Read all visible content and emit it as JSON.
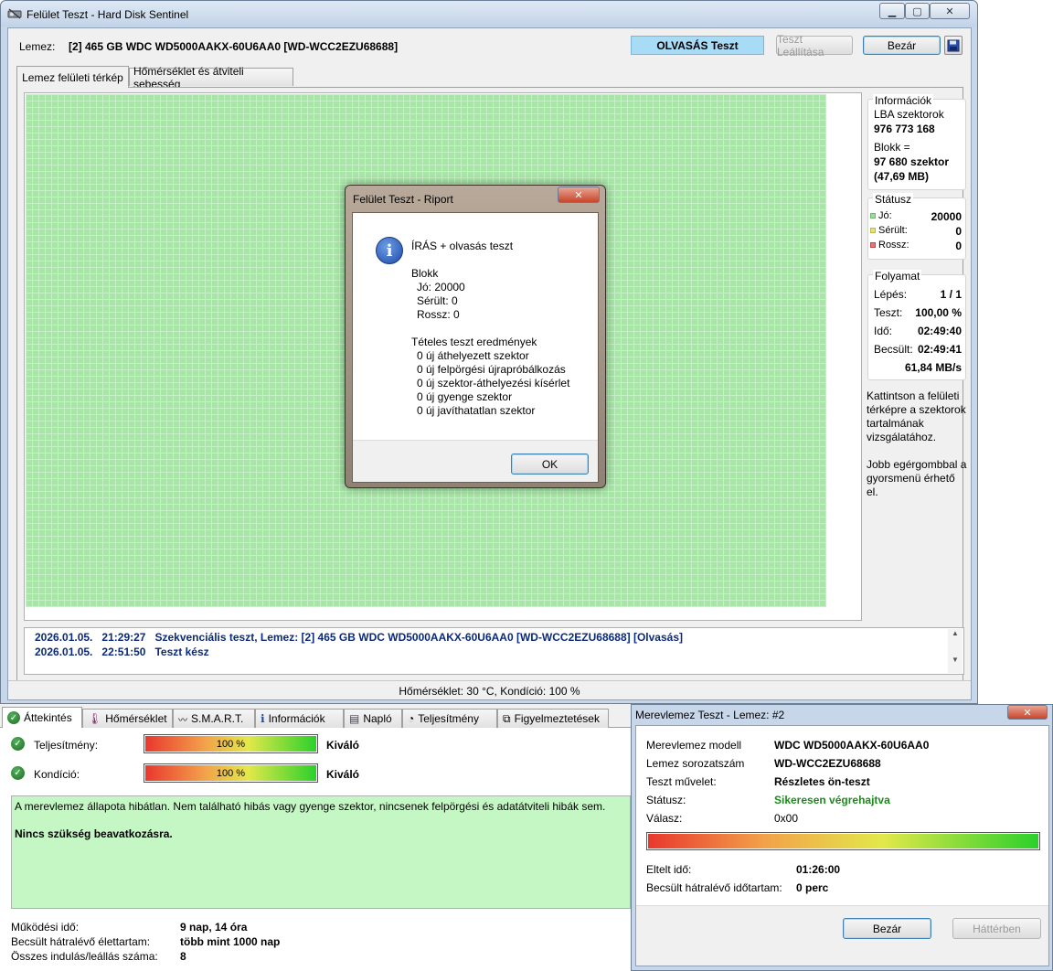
{
  "main_window": {
    "title": "Felület Teszt - Hard Disk Sentinel",
    "disk_label": "Lemez:",
    "disk_value": "[2] 465 GB  WDC WD5000AAKX-60U6AA0 [WD-WCC2EZU68688]",
    "mode_badge": "OLVASÁS Teszt",
    "stop_button": "Teszt Leállítása",
    "close_button": "Bezár",
    "tabs": [
      "Lemez felületi térkép",
      "Hőmérséklet és átviteli sebesség"
    ],
    "info": {
      "title": "Információk",
      "lba_label": "LBA szektorok",
      "lba_value": "976 773 168",
      "block_label": "Blokk =",
      "block_value": "97 680 szektor",
      "block_size": "(47,69 MB)"
    },
    "status": {
      "title": "Státusz",
      "rows": [
        {
          "label": "Jó:",
          "value": "20000",
          "color": "#9fd99f"
        },
        {
          "label": "Sérült:",
          "value": "0",
          "color": "#e5e07a"
        },
        {
          "label": "Rossz:",
          "value": "0",
          "color": "#e07a7a"
        }
      ]
    },
    "progress": {
      "title": "Folyamat",
      "step_label": "Lépés:",
      "step_value": "1 / 1",
      "test_label": "Teszt:",
      "test_value": "100,00 %",
      "time_label": "Idő:",
      "time_value": "02:49:40",
      "est_label": "Becsült:",
      "est_value": "02:49:41",
      "speed": "61,84 MB/s"
    },
    "hint1": "Kattintson a felületi térképre a szektorok tartalmának vizsgálatához.",
    "hint2": "Jobb egérgombbal a gyorsmenü érhető el.",
    "log": [
      {
        "date": "2026.01.05.",
        "time": "21:29:27",
        "text": "Szekvenciális teszt, Lemez: [2] 465 GB  WDC WD5000AAKX-60U6AA0 [WD-WCC2EZU68688] [Olvasás]"
      },
      {
        "date": "2026.01.05.",
        "time": "22:51:50",
        "text": "Teszt kész"
      }
    ],
    "statusbar": "Hőmérséklet: 30  °C,  Kondíció: 100 %",
    "map_color": "#a8e6a8"
  },
  "report_dialog": {
    "title": "Felület Teszt - Riport",
    "heading": "ÍRÁS + olvasás teszt",
    "block_title": "Blokk",
    "block_lines": [
      "Jó: 20000",
      "Sérült: 0",
      "Rossz: 0"
    ],
    "results_title": "Tételes teszt eredmények",
    "result_lines": [
      "0 új áthelyezett szektor",
      "0 új felpörgési újrapróbálkozás",
      "0 új szektor-áthelyezési kísérlet",
      "0 új gyenge szektor",
      "0 új javíthatatlan szektor"
    ],
    "ok_button": "OK"
  },
  "overview": {
    "tabs": [
      "Áttekintés",
      "Hőmérséklet",
      "S.M.A.R.T.",
      "Információk",
      "Napló",
      "Teljesítmény",
      "Figyelmeztetések"
    ],
    "perf_label": "Teljesítmény:",
    "perf_value": "100 %",
    "perf_fraction": 1.0,
    "perf_rating": "Kiváló",
    "cond_label": "Kondíció:",
    "cond_value": "100 %",
    "cond_fraction": 1.0,
    "cond_rating": "Kiváló",
    "message": "A merevlemez állapota hibátlan. Nem található hibás vagy gyenge szektor, nincsenek felpörgési és adatátviteli hibák sem.",
    "message_bold": "Nincs szükség beavatkozásra.",
    "message_bg": "#c4f7c4",
    "stats": [
      {
        "label": "Működési idő:",
        "value": "9 nap, 14 óra"
      },
      {
        "label": "Becsült hátralévő élettartam:",
        "value": "több mint 1000 nap"
      },
      {
        "label": "Összes indulás/leállás száma:",
        "value": "8"
      }
    ]
  },
  "self_test": {
    "title": "Merevlemez Teszt - Lemez: #2",
    "rows": [
      {
        "label": "Merevlemez modell",
        "value": "WDC WD5000AAKX-60U6AA0"
      },
      {
        "label": "Lemez sorozatszám",
        "value": "WD-WCC2EZU68688"
      },
      {
        "label": "Teszt művelet:",
        "value": "Részletes ön-teszt"
      },
      {
        "label": "Státusz:",
        "value": "Sikeresen végrehajtva"
      },
      {
        "label": "Válasz:",
        "value": "0x00"
      }
    ],
    "progress_fraction": 1.0,
    "elapsed_label": "Eltelt idő:",
    "elapsed_value": "01:26:00",
    "remaining_label": "Becsült hátralévő időtartam:",
    "remaining_value": "0 perc",
    "close_button": "Bezár",
    "background_button": "Háttérben",
    "success_color": "#1e8a1e"
  }
}
